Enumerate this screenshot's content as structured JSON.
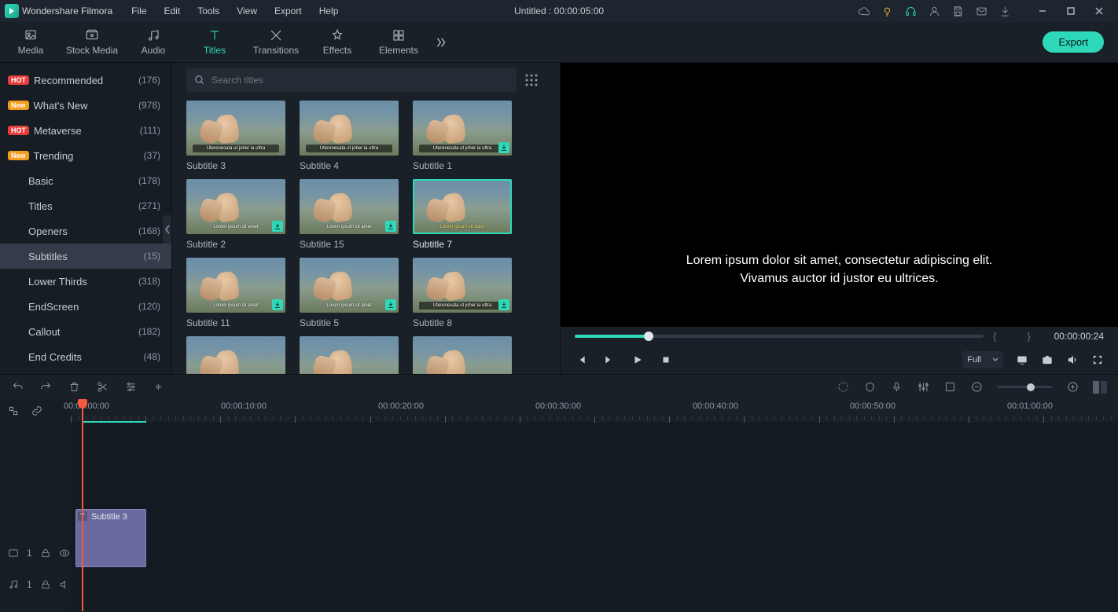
{
  "app_name": "Wondershare Filmora",
  "menu": [
    "File",
    "Edit",
    "Tools",
    "View",
    "Export",
    "Help"
  ],
  "doc_title": "Untitled : 00:00:05:00",
  "tool_tabs": [
    {
      "id": "media",
      "label": "Media"
    },
    {
      "id": "stock",
      "label": "Stock Media"
    },
    {
      "id": "audio",
      "label": "Audio"
    },
    {
      "id": "titles",
      "label": "Titles",
      "active": true
    },
    {
      "id": "transitions",
      "label": "Transitions"
    },
    {
      "id": "effects",
      "label": "Effects"
    },
    {
      "id": "elements",
      "label": "Elements"
    }
  ],
  "export_label": "Export",
  "sidebar": [
    {
      "badge": "HOT",
      "badge_class": "hot",
      "label": "Recommended",
      "count": "(176)"
    },
    {
      "badge": "New",
      "badge_class": "new",
      "label": "What's New",
      "count": "(978)"
    },
    {
      "badge": "HOT",
      "badge_class": "hot",
      "label": "Metaverse",
      "count": "(111)"
    },
    {
      "badge": "New",
      "badge_class": "new",
      "label": "Trending",
      "count": "(37)"
    },
    {
      "indent": true,
      "label": "Basic",
      "count": "(178)"
    },
    {
      "indent": true,
      "label": "Titles",
      "count": "(271)"
    },
    {
      "indent": true,
      "label": "Openers",
      "count": "(168)"
    },
    {
      "indent": true,
      "label": "Subtitles",
      "count": "(15)",
      "active": true
    },
    {
      "indent": true,
      "label": "Lower Thirds",
      "count": "(318)"
    },
    {
      "indent": true,
      "label": "EndScreen",
      "count": "(120)"
    },
    {
      "indent": true,
      "label": "Callout",
      "count": "(182)"
    },
    {
      "indent": true,
      "label": "End Credits",
      "count": "(48)"
    }
  ],
  "search_placeholder": "Search titles",
  "thumbs": [
    {
      "name": "Subtitle 3",
      "sub": "Uterenesata ut joher ia uttra",
      "sub_class": "bar"
    },
    {
      "name": "Subtitle 4",
      "sub": "Uterenesata ut joher ia uttra",
      "sub_class": "bar"
    },
    {
      "name": "Subtitle 1",
      "sub": "Uterenesata ut joher ia uttra",
      "sub_class": "bar",
      "dl": true
    },
    {
      "name": "Subtitle 2",
      "sub": "Lorem ipsum sit amet",
      "sub_class": "",
      "dl": true
    },
    {
      "name": "Subtitle 15",
      "sub": "Lorem ipsum sit amet",
      "sub_class": "",
      "dl": true
    },
    {
      "name": "Subtitle 7",
      "sub": "Lorem ipsum sit dolor",
      "sub_class": "yellow",
      "selected": true
    },
    {
      "name": "Subtitle 11",
      "sub": "Lorem ipsum sit amet",
      "sub_class": "",
      "dl": true
    },
    {
      "name": "Subtitle 5",
      "sub": "Lorem ipsum sit amet",
      "sub_class": "",
      "dl": true
    },
    {
      "name": "Subtitle 8",
      "sub": "Uterenesata ut joher ia uttra",
      "sub_class": "bar",
      "dl": true
    }
  ],
  "preview_line1": "Lorem ipsum dolor sit amet, consectetur adipiscing elit.",
  "preview_line2": "Vivamus auctor id justor eu ultrices.",
  "preview_tc": "00:00:00:24",
  "quality_label": "Full",
  "ruler": [
    "00:00:00:00",
    "00:00:10:00",
    "00:00:20:00",
    "00:00:30:00",
    "00:00:40:00",
    "00:00:50:00",
    "00:01:00:00"
  ],
  "clip_name": "Subtitle 3",
  "track_video_label": "1",
  "track_audio_label": "1"
}
